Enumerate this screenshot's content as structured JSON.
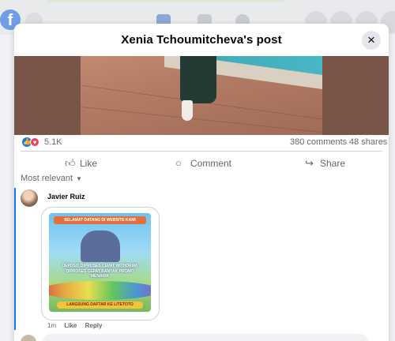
{
  "background": {
    "logo_letter": "f"
  },
  "post": {
    "title": "Xenia Tchoumitcheva's post",
    "close_icon": "×",
    "reactions": {
      "like_icon": "👍",
      "love_icon": "♥",
      "count": "5.1K"
    },
    "comments_count": "380 comments",
    "shares_count": "48 shares"
  },
  "actions": {
    "like": "Like",
    "comment": "Comment",
    "share": "Share"
  },
  "filter": {
    "label": "Most relevant",
    "caret": "▼"
  },
  "comment": {
    "author": "Javier Ruiz",
    "banner": {
      "top_text": "SELAMAT DATANG DI WEBSITE KAMI",
      "middle_text": "DEPOSIT DIPROSES CEPAT WITHDRAW DIPROSES CEPAT BANYAK PROMO MENARIK",
      "cta_text": "LANGSUNG DAFTAR KE LITETOTO"
    },
    "time": "1m",
    "like": "Like",
    "reply": "Reply"
  },
  "colors": {
    "accent": "#1877f2",
    "love": "#f33e58",
    "muted_text": "#65676b"
  }
}
